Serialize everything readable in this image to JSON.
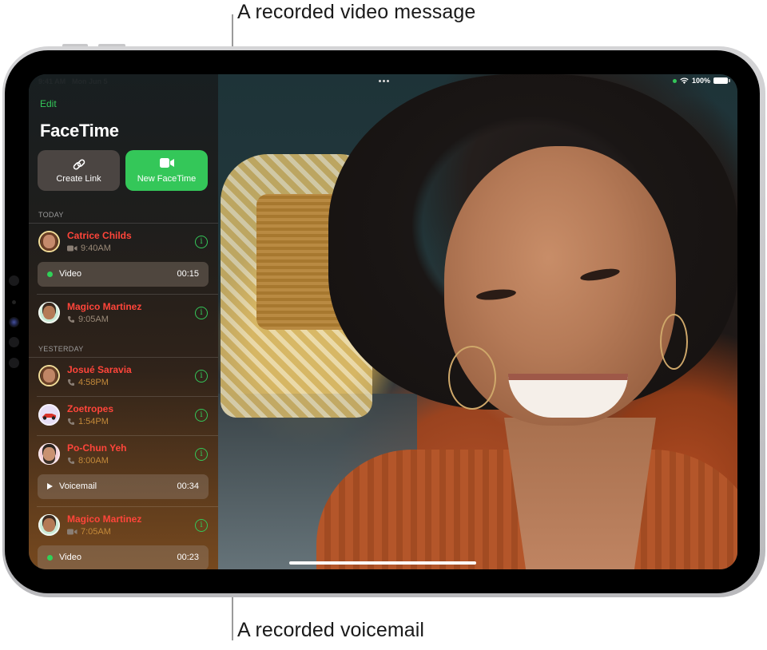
{
  "callouts": {
    "top": "A recorded video message",
    "bottom": "A recorded voicemail"
  },
  "status_bar": {
    "time": "9:41 AM",
    "date": "Mon Jun 5",
    "battery": "100%",
    "multitasking_icon": "ellipsis-icon",
    "wifi_icon": "wifi-icon",
    "battery_icon": "battery-icon"
  },
  "colors": {
    "accent_green": "#34c759",
    "missed_red": "#ff453a"
  },
  "sidebar": {
    "edit_label": "Edit",
    "title": "FaceTime",
    "create_link": {
      "label": "Create Link",
      "icon": "link-icon"
    },
    "new_facetime": {
      "label": "New FaceTime",
      "icon": "video-camera-icon"
    },
    "sections": [
      {
        "header": "TODAY",
        "calls": [
          {
            "name": "Catrice Childs",
            "type": "video",
            "time": "9:40AM",
            "message": {
              "kind": "video",
              "label": "Video",
              "duration": "00:15"
            }
          },
          {
            "name": "Magico Martinez",
            "type": "audio",
            "time": "9:05AM"
          }
        ]
      },
      {
        "header": "YESTERDAY",
        "calls": [
          {
            "name": "Josué Saravia",
            "type": "audio",
            "time": "4:58PM"
          },
          {
            "name": "Zoetropes",
            "type": "audio",
            "time": "1:54PM"
          },
          {
            "name": "Po-Chun Yeh",
            "type": "audio",
            "time": "8:00AM",
            "message": {
              "kind": "voicemail",
              "label": "Voicemail",
              "duration": "00:34"
            }
          },
          {
            "name": "Magico Martinez",
            "type": "video",
            "time": "7:05AM",
            "message": {
              "kind": "video",
              "label": "Video",
              "duration": "00:23"
            }
          }
        ]
      }
    ]
  }
}
